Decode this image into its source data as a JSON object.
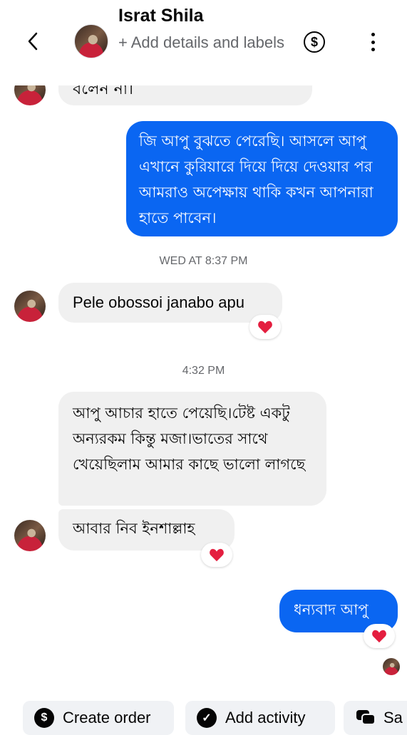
{
  "header": {
    "name": "Israt Shila",
    "subtitle": "+ Add details and labels",
    "dollar_icon": "$"
  },
  "messages": {
    "partial_top_text": "বলেন না।",
    "out1": "জি আপু বুঝতে পেরেছি। আসলে আপু এখানে কুরিয়ারে দিয়ে দিয়ে দেওয়ার পর আমরাও অপেক্ষায় থাকি কখন আপনারা হাতে পাবেন।",
    "ts1": "WED AT 8:37 PM",
    "in1": "Pele obossoi janabo apu",
    "ts2": "4:32 PM",
    "in2": "আপু আচার হাতে পেয়েছি।টেষ্ট একটু অন্যরকম কিন্তু মজা।ভাতের সাথে খেয়েছিলাম আমার কাছে ভালো লাগছে",
    "in3": "আবার নিব ইনশাল্লাহ",
    "out2": "ধন্যবাদ আপু"
  },
  "actions": {
    "create_order": "Create order",
    "add_activity": "Add activity",
    "third_partial": "Sa"
  },
  "colors": {
    "outgoing_bubble": "#0a66f2",
    "incoming_bubble": "#f0f0f0",
    "reaction_heart": "#e41e3f"
  }
}
